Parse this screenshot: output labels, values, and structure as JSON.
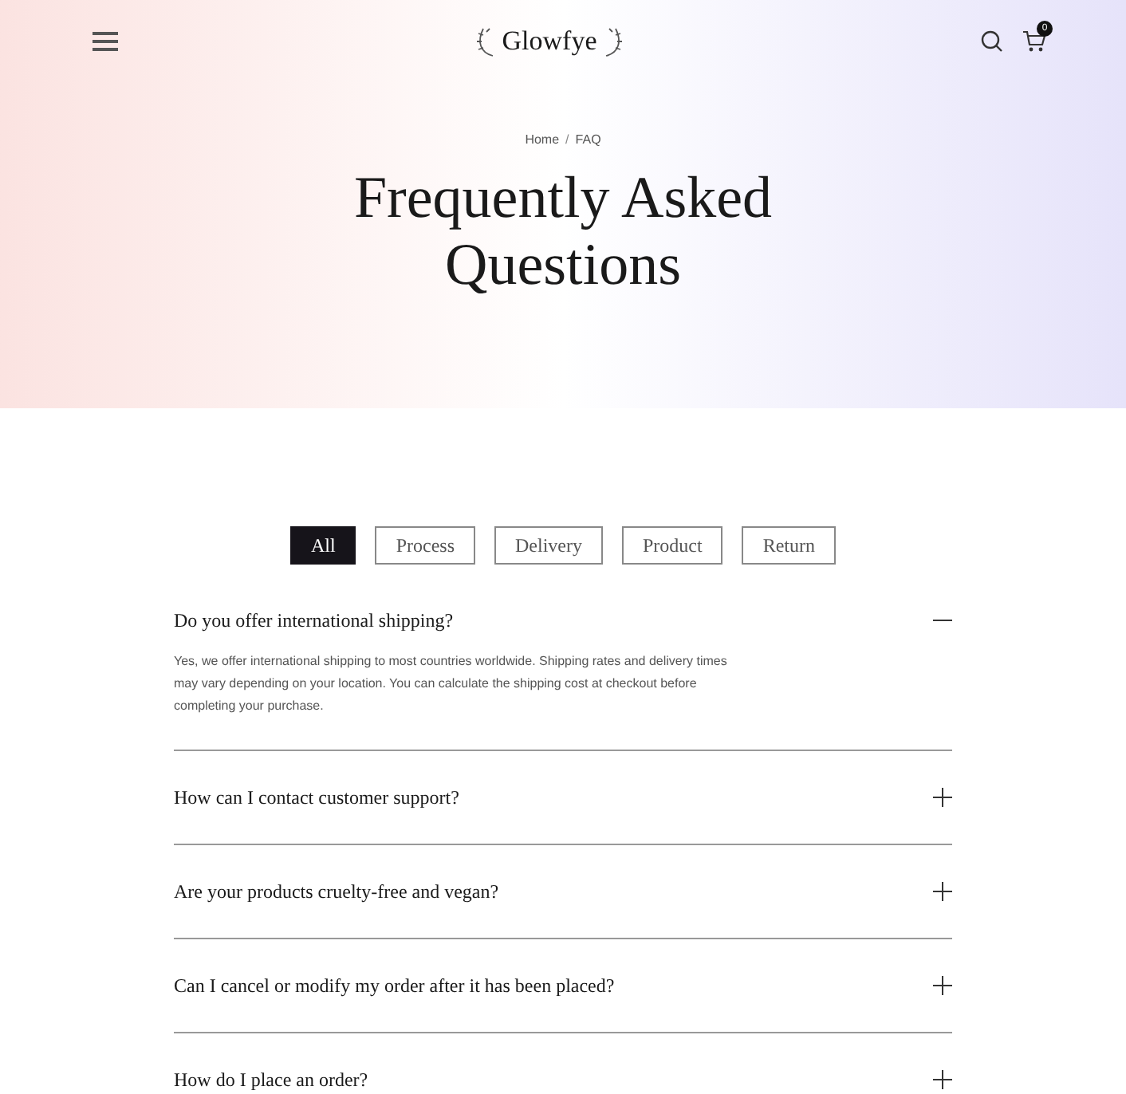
{
  "header": {
    "logo": "Glowfye",
    "cart_count": "0"
  },
  "breadcrumb": [
    "Home",
    "FAQ"
  ],
  "breadcrumb_separator": "/",
  "title": "Frequently Asked Questions",
  "tabs": [
    {
      "label": "All",
      "selected": true
    },
    {
      "label": "Process",
      "selected": false
    },
    {
      "label": "Delivery",
      "selected": false
    },
    {
      "label": "Product",
      "selected": false
    },
    {
      "label": "Return",
      "selected": false
    }
  ],
  "faqs": [
    {
      "question": "Do you offer international shipping?",
      "expanded": true,
      "answer": "Yes, we offer international shipping to most countries worldwide. Shipping rates and delivery times may vary depending on your location. You can calculate the shipping cost at checkout before completing your purchase."
    },
    {
      "question": "How can I contact customer support?",
      "expanded": false
    },
    {
      "question": "Are your products cruelty-free and vegan?",
      "expanded": false
    },
    {
      "question": "Can I cancel or modify my order after it has been placed?",
      "expanded": false
    },
    {
      "question": "How do I place an order?",
      "expanded": false
    }
  ]
}
